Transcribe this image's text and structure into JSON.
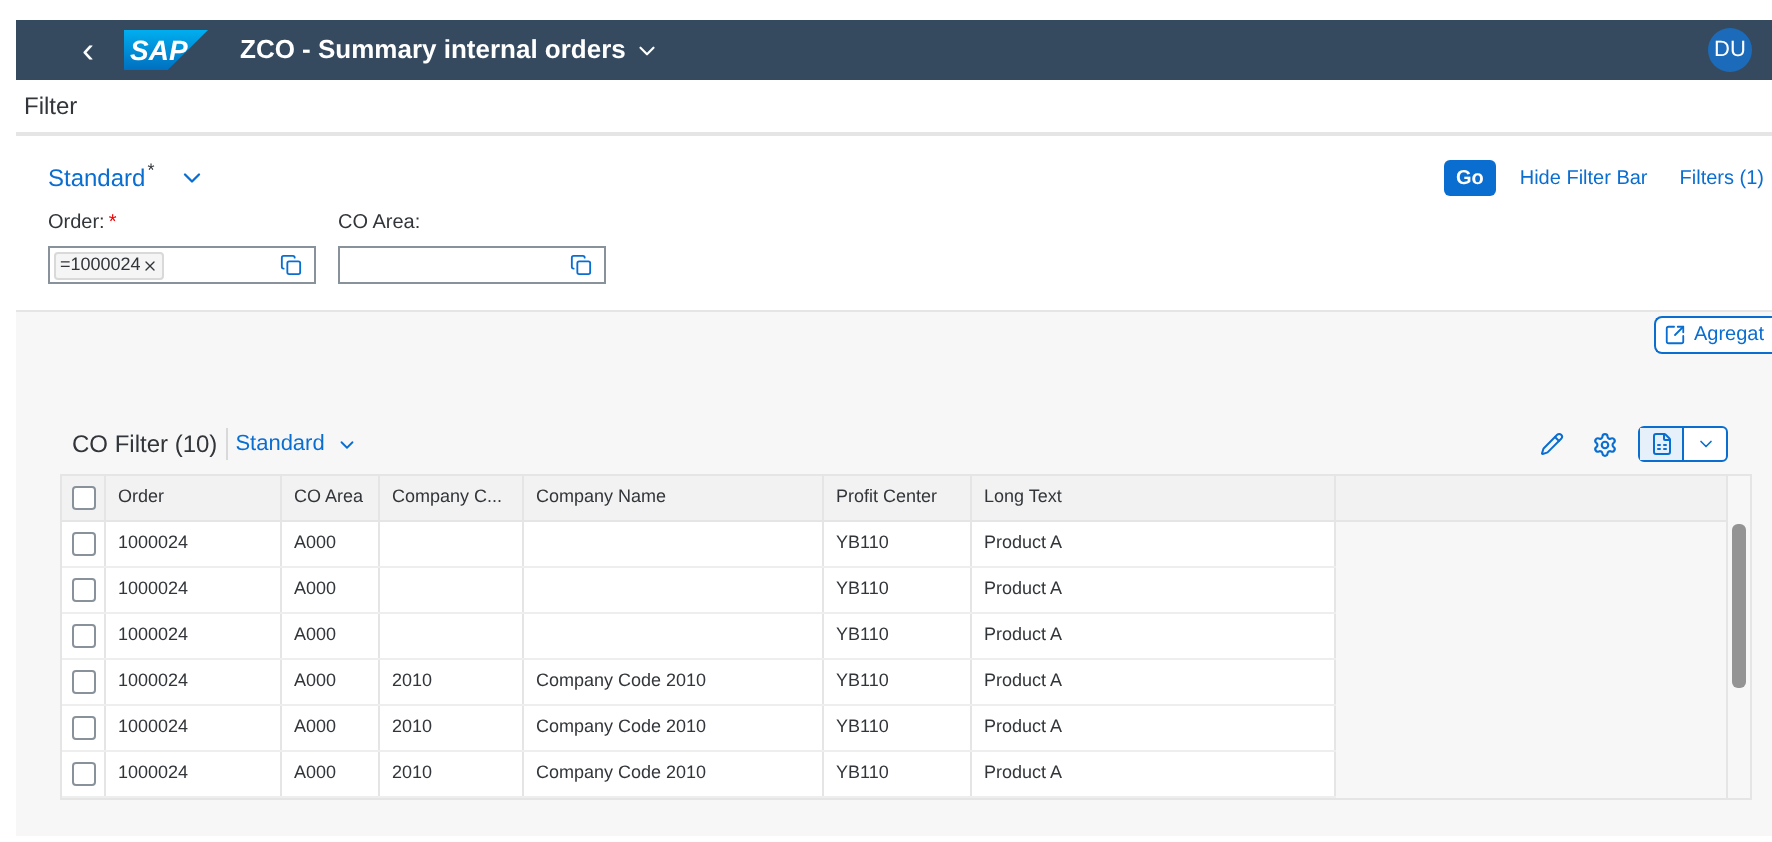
{
  "shell": {
    "back": "‹",
    "logo": "SAP",
    "title": "ZCO - Summary internal orders",
    "avatar": "DU"
  },
  "page_title": "Filter",
  "filter_bar": {
    "variant": "Standard",
    "variant_modified": "*",
    "fields": [
      {
        "label": "Order:",
        "required": true,
        "tokens": [
          "=1000024"
        ]
      },
      {
        "label": "CO Area:",
        "required": false
      }
    ],
    "go": "Go",
    "hide": "Hide Filter Bar",
    "filters": "Filters (1)"
  },
  "aggregate_button": "Agregat",
  "table": {
    "title": "CO Filter (10)",
    "variant": "Standard",
    "select_all": false,
    "columns": [
      "Order",
      "CO Area",
      "Company C...",
      "Company Name",
      "Profit Center",
      "Long Text"
    ],
    "rows": [
      {
        "selected": false,
        "cells": [
          "1000024",
          "A000",
          "",
          "",
          "YB110",
          "Product A"
        ]
      },
      {
        "selected": false,
        "cells": [
          "1000024",
          "A000",
          "",
          "",
          "YB110",
          "Product A"
        ]
      },
      {
        "selected": false,
        "cells": [
          "1000024",
          "A000",
          "",
          "",
          "YB110",
          "Product A"
        ]
      },
      {
        "selected": false,
        "cells": [
          "1000024",
          "A000",
          "2010",
          "Company Code 2010",
          "YB110",
          "Product A"
        ]
      },
      {
        "selected": false,
        "cells": [
          "1000024",
          "A000",
          "2010",
          "Company Code 2010",
          "YB110",
          "Product A"
        ]
      },
      {
        "selected": false,
        "cells": [
          "1000024",
          "A000",
          "2010",
          "Company Code 2010",
          "YB110",
          "Product A"
        ]
      }
    ]
  }
}
